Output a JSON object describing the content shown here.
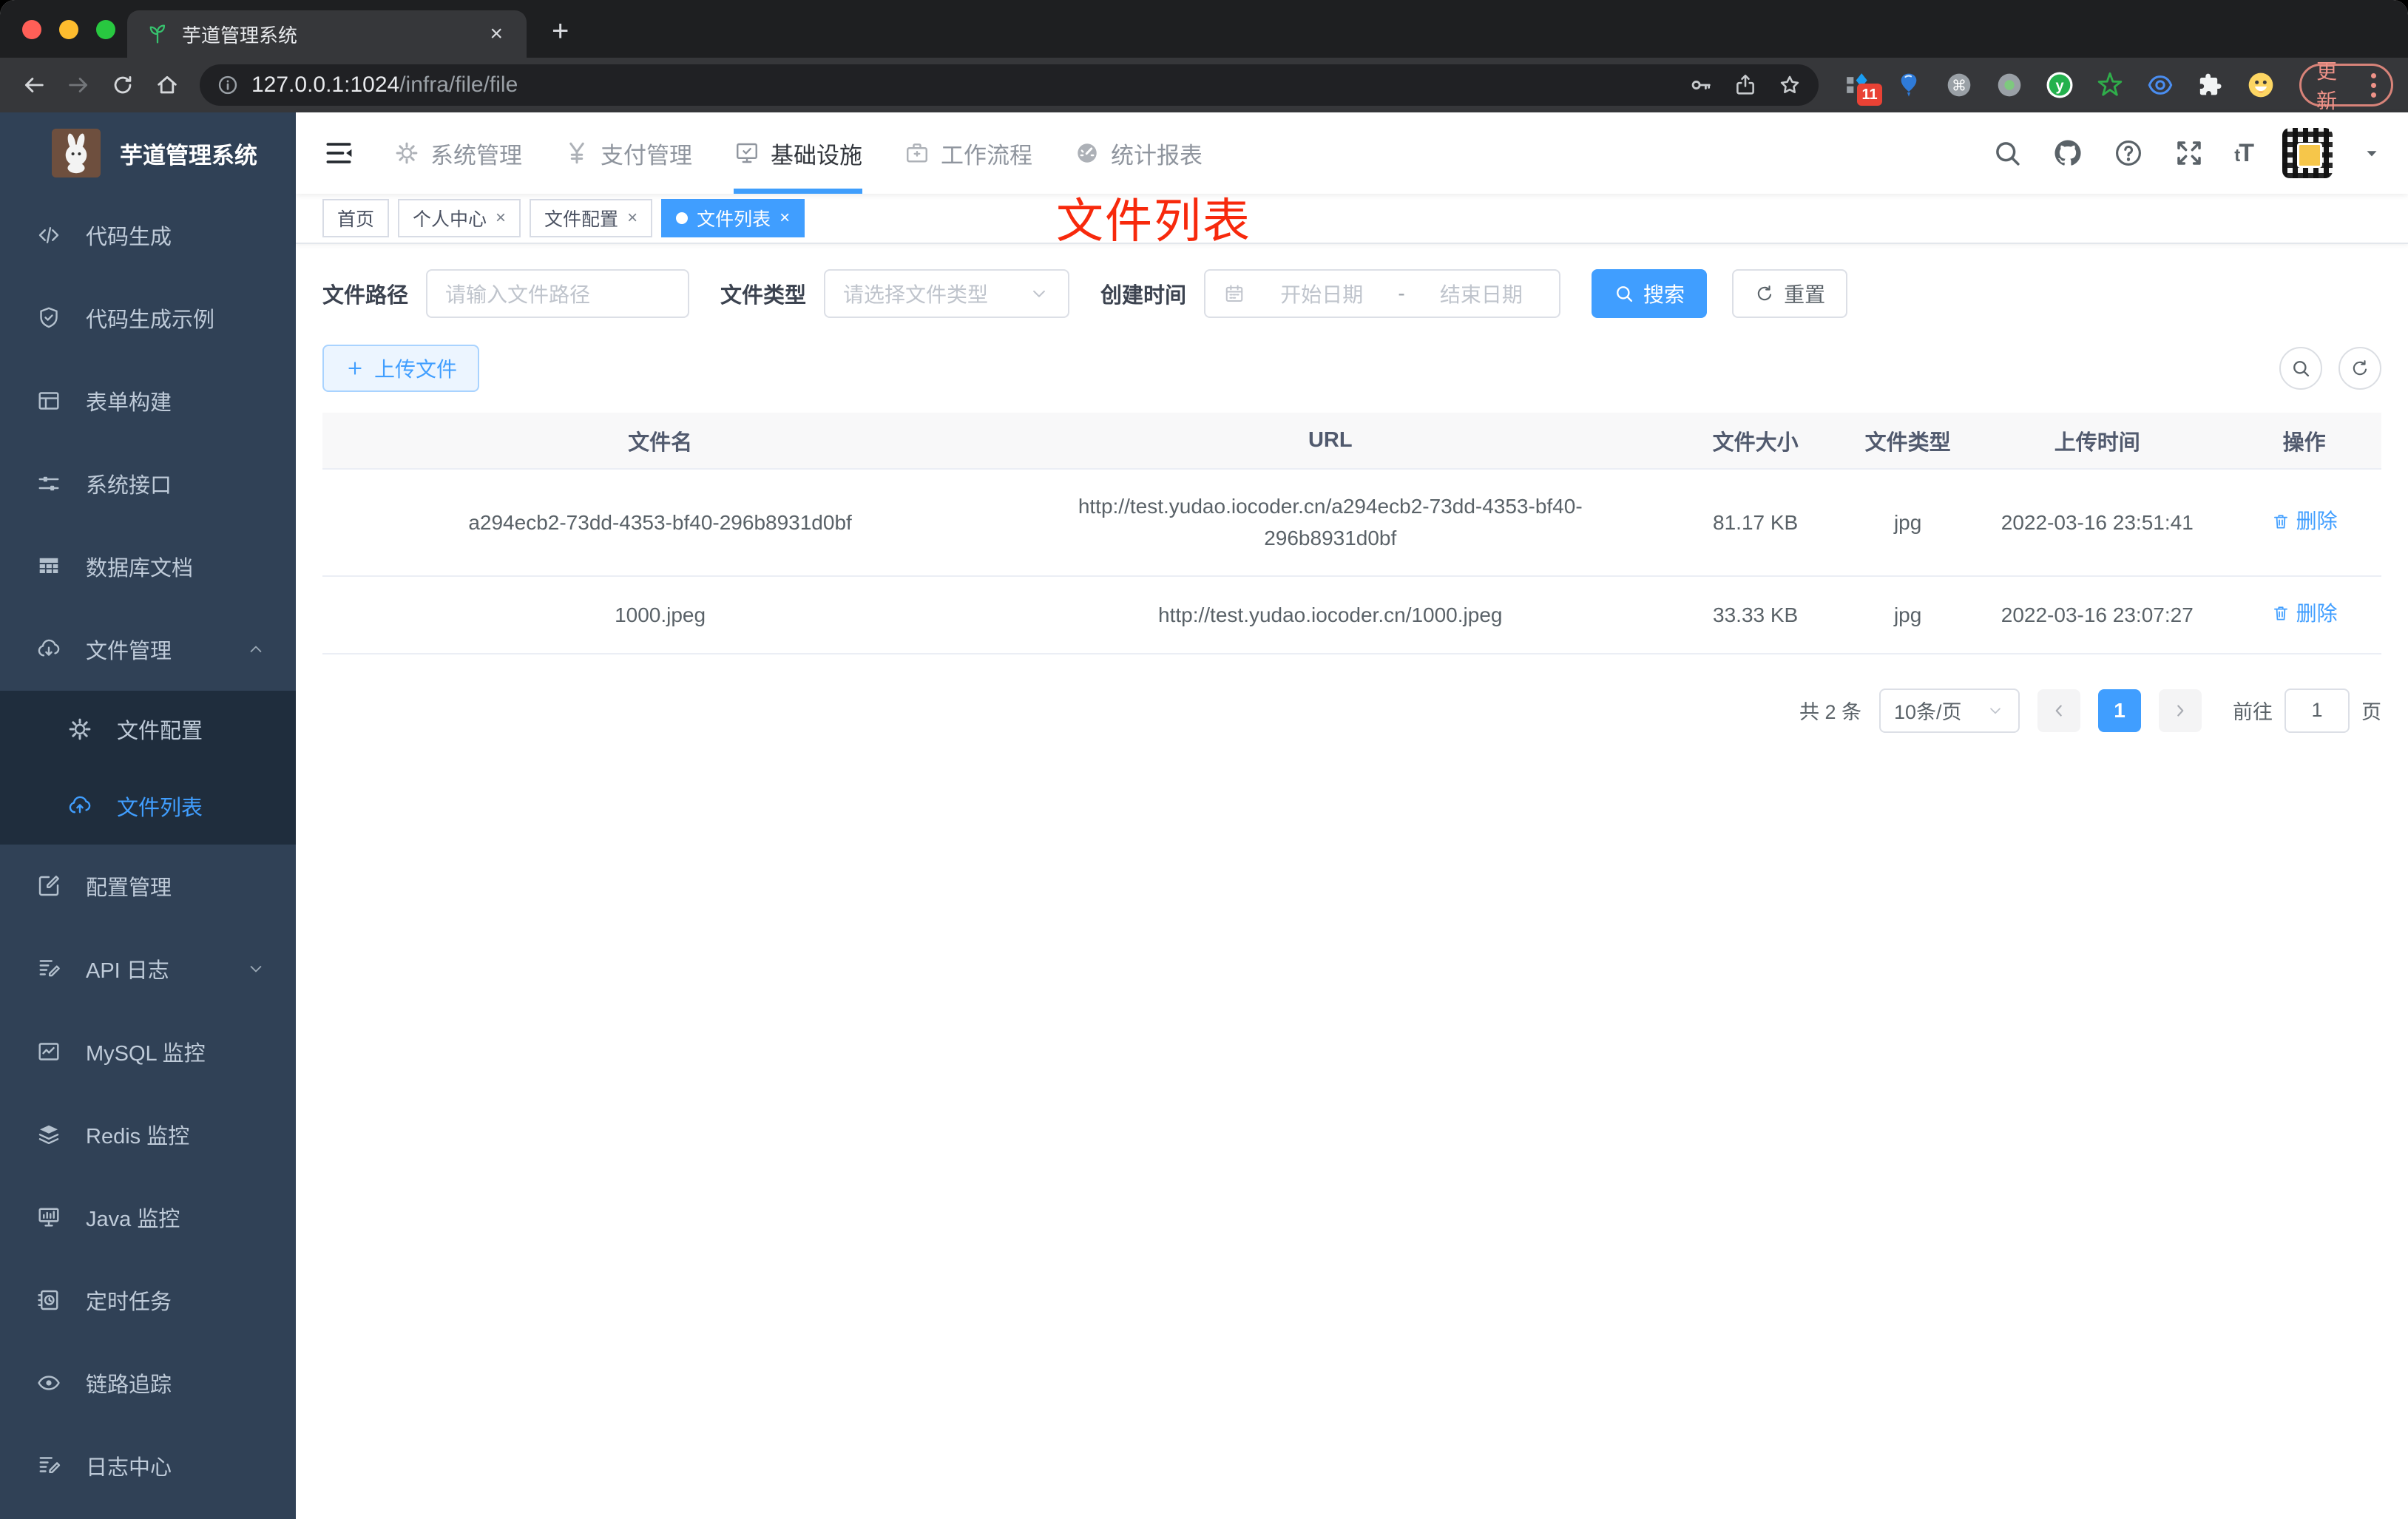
{
  "colors": {
    "accent": "#409eff",
    "annotation_red": "#f7290c",
    "sidebar_bg": "#304156",
    "submenu_bg": "#1f2d3d"
  },
  "browser": {
    "tab_title": "芋道管理系统",
    "tab_close_glyph": "×",
    "new_tab_glyph": "+",
    "url_host": "127.0.0.1:1024",
    "url_path": "/infra/file/file",
    "update_label": "更新",
    "extension_badge": "11",
    "extensions": [
      "extension-grid-icon",
      "balloon-icon",
      "command-circle-icon",
      "dot-circle-icon",
      "y-brand-circle-icon",
      "green-star-icon",
      "blue-eye-icon",
      "puzzle-icon",
      "emoji-face-icon"
    ]
  },
  "sidebar": {
    "title": "芋道管理系统",
    "items": [
      {
        "label": "代码生成",
        "icon": "code-icon"
      },
      {
        "label": "代码生成示例",
        "icon": "shield-check-icon"
      },
      {
        "label": "表单构建",
        "icon": "form-icon"
      },
      {
        "label": "系统接口",
        "icon": "sliders-icon"
      },
      {
        "label": "数据库文档",
        "icon": "database-table-icon"
      },
      {
        "label": "文件管理",
        "icon": "cloud-download-icon",
        "expandable": true,
        "expanded": true
      },
      {
        "label": "文件配置",
        "icon": "gear-icon",
        "sub": true
      },
      {
        "label": "文件列表",
        "icon": "cloud-upload-icon",
        "sub": true,
        "active": true
      },
      {
        "label": "配置管理",
        "icon": "edit-square-icon"
      },
      {
        "label": "API 日志",
        "icon": "document-edit-icon",
        "expandable": true,
        "expanded": false
      },
      {
        "label": "MySQL 监控",
        "icon": "chart-box-icon"
      },
      {
        "label": "Redis 监控",
        "icon": "layers-icon"
      },
      {
        "label": "Java 监控",
        "icon": "monitor-icon"
      },
      {
        "label": "定时任务",
        "icon": "schedule-icon"
      },
      {
        "label": "链路追踪",
        "icon": "eye-icon"
      },
      {
        "label": "日志中心",
        "icon": "log-edit-icon"
      }
    ]
  },
  "header": {
    "nav": [
      {
        "label": "系统管理",
        "icon": "gear-icon"
      },
      {
        "label": "支付管理",
        "icon": "yen-icon"
      },
      {
        "label": "基础设施",
        "icon": "infra-monitor-icon",
        "active": true
      },
      {
        "label": "工作流程",
        "icon": "briefcase-icon"
      },
      {
        "label": "统计报表",
        "icon": "dashboard-icon"
      }
    ],
    "right_icons": [
      "search-icon",
      "github-icon",
      "help-icon",
      "fullscreen-icon"
    ],
    "font_size_icon_text": "tT"
  },
  "tags": [
    {
      "label": "首页"
    },
    {
      "label": "个人中心",
      "closable": true
    },
    {
      "label": "文件配置",
      "closable": true
    },
    {
      "label": "文件列表",
      "closable": true,
      "active": true
    }
  ],
  "annotation": "文件列表",
  "filters": {
    "path_label": "文件路径",
    "path_placeholder": "请输入文件路径",
    "type_label": "文件类型",
    "type_placeholder": "请选择文件类型",
    "date_label": "创建时间",
    "date_start_placeholder": "开始日期",
    "date_separator": "-",
    "date_end_placeholder": "结束日期",
    "search_label": "搜索",
    "reset_label": "重置"
  },
  "toolbar": {
    "upload_label": "上传文件"
  },
  "table": {
    "headers": [
      "文件名",
      "URL",
      "文件大小",
      "文件类型",
      "上传时间",
      "操作"
    ],
    "col_widths": [
      "32.8%",
      "32.3%",
      "9%",
      "5.8%",
      "12.6%",
      "7.5%"
    ],
    "delete_label": "删除",
    "rows": [
      {
        "name": "a294ecb2-73dd-4353-bf40-296b8931d0bf",
        "url": "http://test.yudao.iocoder.cn/a294ecb2-73dd-4353-bf40-296b8931d0bf",
        "size": "81.17 KB",
        "type": "jpg",
        "time": "2022-03-16 23:51:41"
      },
      {
        "name": "1000.jpeg",
        "url": "http://test.yudao.iocoder.cn/1000.jpeg",
        "size": "33.33 KB",
        "type": "jpg",
        "time": "2022-03-16 23:07:27"
      }
    ]
  },
  "pagination": {
    "total_text": "共 2 条",
    "per_page_text": "10条/页",
    "current_page": "1",
    "goto_label": "前往",
    "goto_value": "1",
    "goto_suffix": "页"
  }
}
